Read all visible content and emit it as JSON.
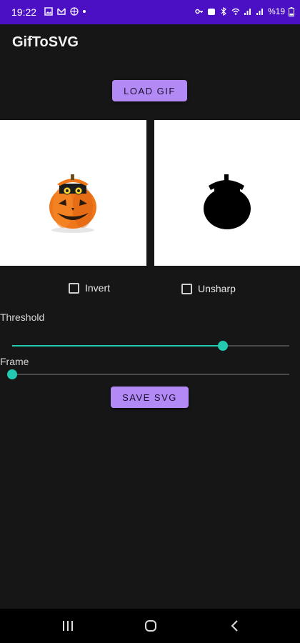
{
  "status_bar": {
    "time": "19:22",
    "battery": "%19"
  },
  "app": {
    "title": "GifToSVG"
  },
  "actions": {
    "load_label": "LOAD GIF",
    "save_label": "SAVE SVG"
  },
  "options": {
    "invert_label": "Invert",
    "invert_checked": false,
    "unsharp_label": "Unsharp",
    "unsharp_checked": false
  },
  "sliders": {
    "threshold": {
      "label": "Threshold",
      "value": 0.76
    },
    "frame": {
      "label": "Frame",
      "value": 0.0
    }
  },
  "colors": {
    "status_bar": "#4c10c4",
    "accent_button": "#b38af5",
    "slider": "#23c9b0",
    "background": "#161616"
  }
}
